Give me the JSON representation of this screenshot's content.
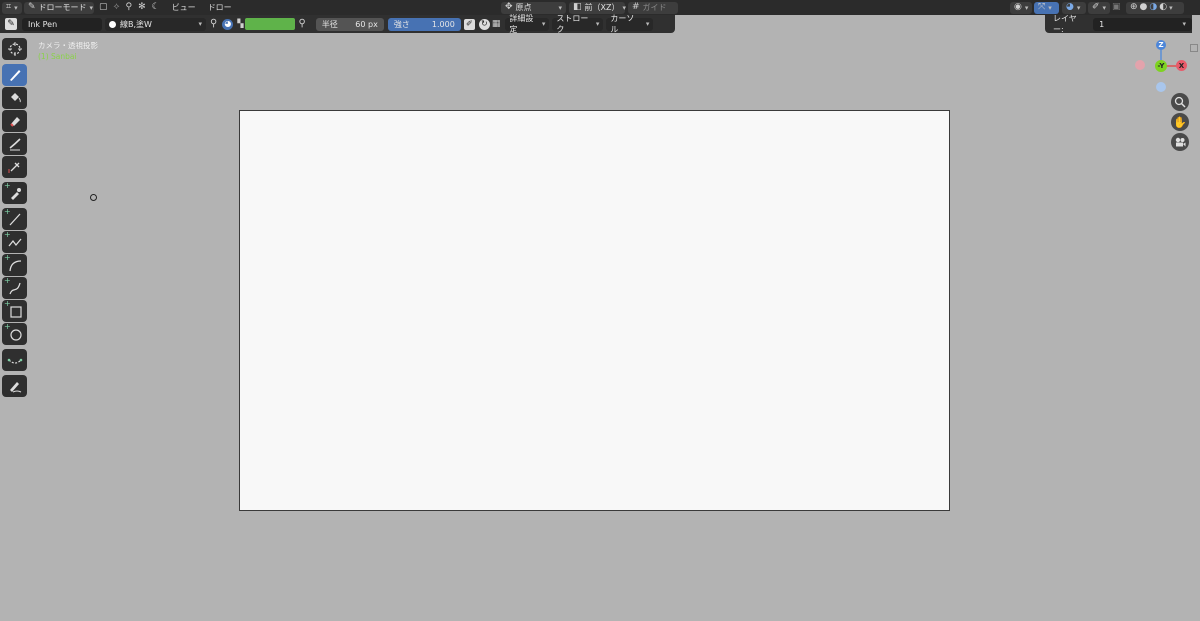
{
  "header": {
    "mode": "ドローモード",
    "menus": [
      "ビュー",
      "ドロー"
    ],
    "pivot": "原点",
    "orientation": "前（XZ）",
    "guides": "ガイド"
  },
  "tool_settings": {
    "brush_name": "Ink Pen",
    "material": "線B,塗W",
    "color_hex": "#5fb34a",
    "radius_label": "半径",
    "radius_value": "60 px",
    "strength_label": "強さ",
    "strength_value": "1.000",
    "advanced": "詳細設定",
    "stroke": "ストローク",
    "cursor": "カーソル",
    "layer_label": "レイヤー:",
    "layer_value": "1"
  },
  "viewport": {
    "title": "カメラ・透視投影",
    "object": "(1) Sanbai"
  },
  "gizmo": {
    "z": "Z",
    "y": "-Y",
    "x": "X"
  },
  "tools": [
    "cursor-tool",
    "draw-tool",
    "fill-tool",
    "erase-tool",
    "tint-tool",
    "cutter-tool",
    "eyedropper-tool",
    "line-tool",
    "polyline-tool",
    "arc-tool",
    "curve-tool",
    "box-tool",
    "circle-tool",
    "interpolate-tool",
    "annotate-tool"
  ],
  "colors": {
    "accent": "#4772b3",
    "background": "#b3b3b3",
    "object_text": "#8ad24a"
  }
}
